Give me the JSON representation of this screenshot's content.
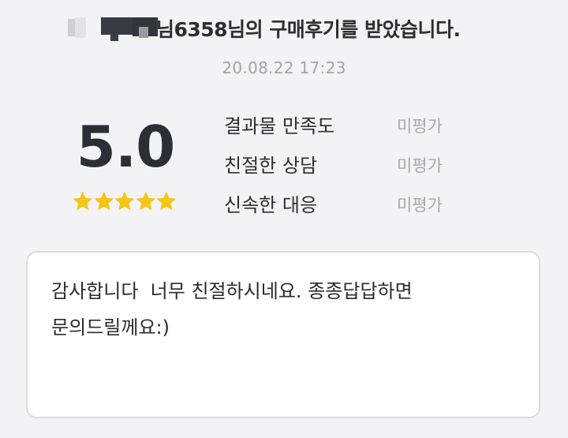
{
  "header": {
    "title": "님6358님의 구매후기를 받았습니다."
  },
  "timestamp": "20.08.22 17:23",
  "rating": {
    "score": "5.0",
    "stars": 5,
    "star_color": "#f5c518"
  },
  "criteria": [
    {
      "label": "결과물 만족도",
      "value": "미평가"
    },
    {
      "label": "친절한 상담",
      "value": "미평가"
    },
    {
      "label": "신속한 대응",
      "value": "미평가"
    }
  ],
  "review": {
    "text": "감사합니다  너무 친절하시네요. 종종답답하면\n문의드릴께요:)"
  }
}
